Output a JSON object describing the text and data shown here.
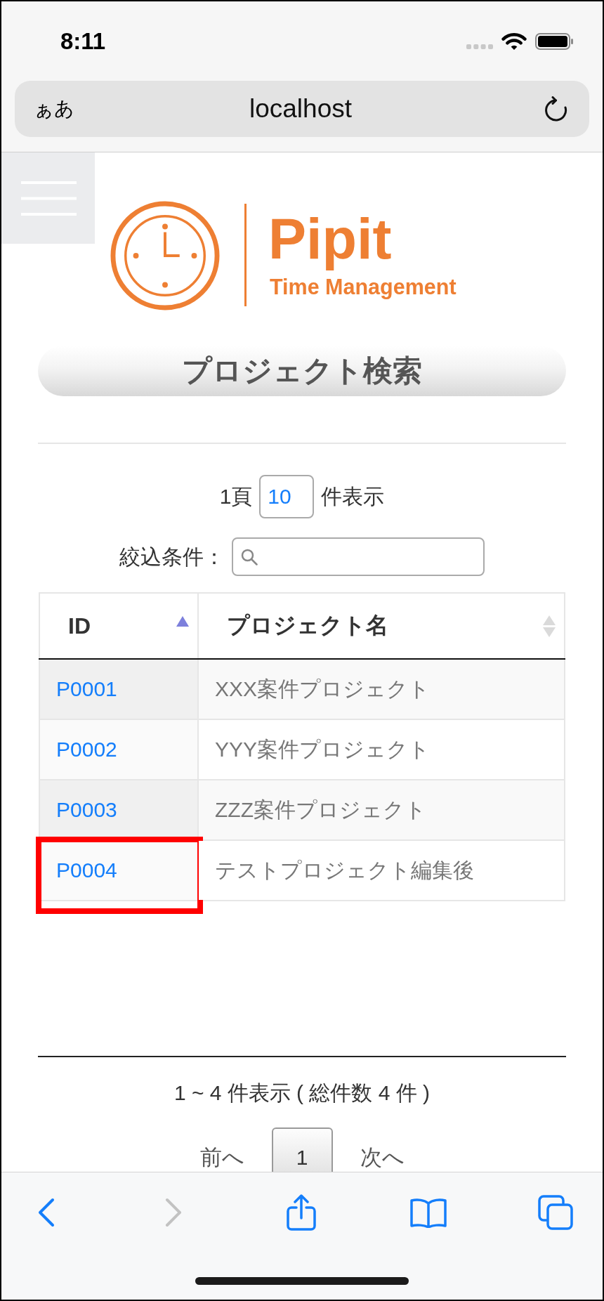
{
  "status_bar": {
    "time": "8:11"
  },
  "address_bar": {
    "text_size_button": "ぁあ",
    "url": "localhost"
  },
  "page": {
    "logo": {
      "name": "Pipit",
      "tagline": "Time Management"
    },
    "title": "プロジェクト検索",
    "page_size": {
      "prefix": "1頁",
      "value": "10",
      "suffix": "件表示"
    },
    "filter": {
      "label": "絞込条件："
    },
    "table": {
      "columns": [
        {
          "label": "ID",
          "sorted": true
        },
        {
          "label": "プロジェクト名",
          "sorted": false
        }
      ],
      "rows": [
        {
          "id": "P0001",
          "name": "XXX案件プロジェクト",
          "highlighted": false
        },
        {
          "id": "P0002",
          "name": "YYY案件プロジェクト",
          "highlighted": false
        },
        {
          "id": "P0003",
          "name": "ZZZ案件プロジェクト",
          "highlighted": false
        },
        {
          "id": "P0004",
          "name": "テストプロジェクト編集後",
          "highlighted": true
        }
      ]
    },
    "summary": "1 ~ 4 件表示 ( 総件数 4 件 )",
    "pagination": {
      "previous": "前へ",
      "pages": [
        {
          "label": "1",
          "selected": true
        }
      ],
      "next": "次へ"
    }
  },
  "toolbar": {
    "buttons": [
      {
        "kind": "back",
        "disabled": false
      },
      {
        "kind": "forward",
        "disabled": true
      },
      {
        "kind": "share",
        "disabled": false
      },
      {
        "kind": "bookmarks",
        "disabled": false
      },
      {
        "kind": "tabs",
        "disabled": false
      }
    ]
  }
}
